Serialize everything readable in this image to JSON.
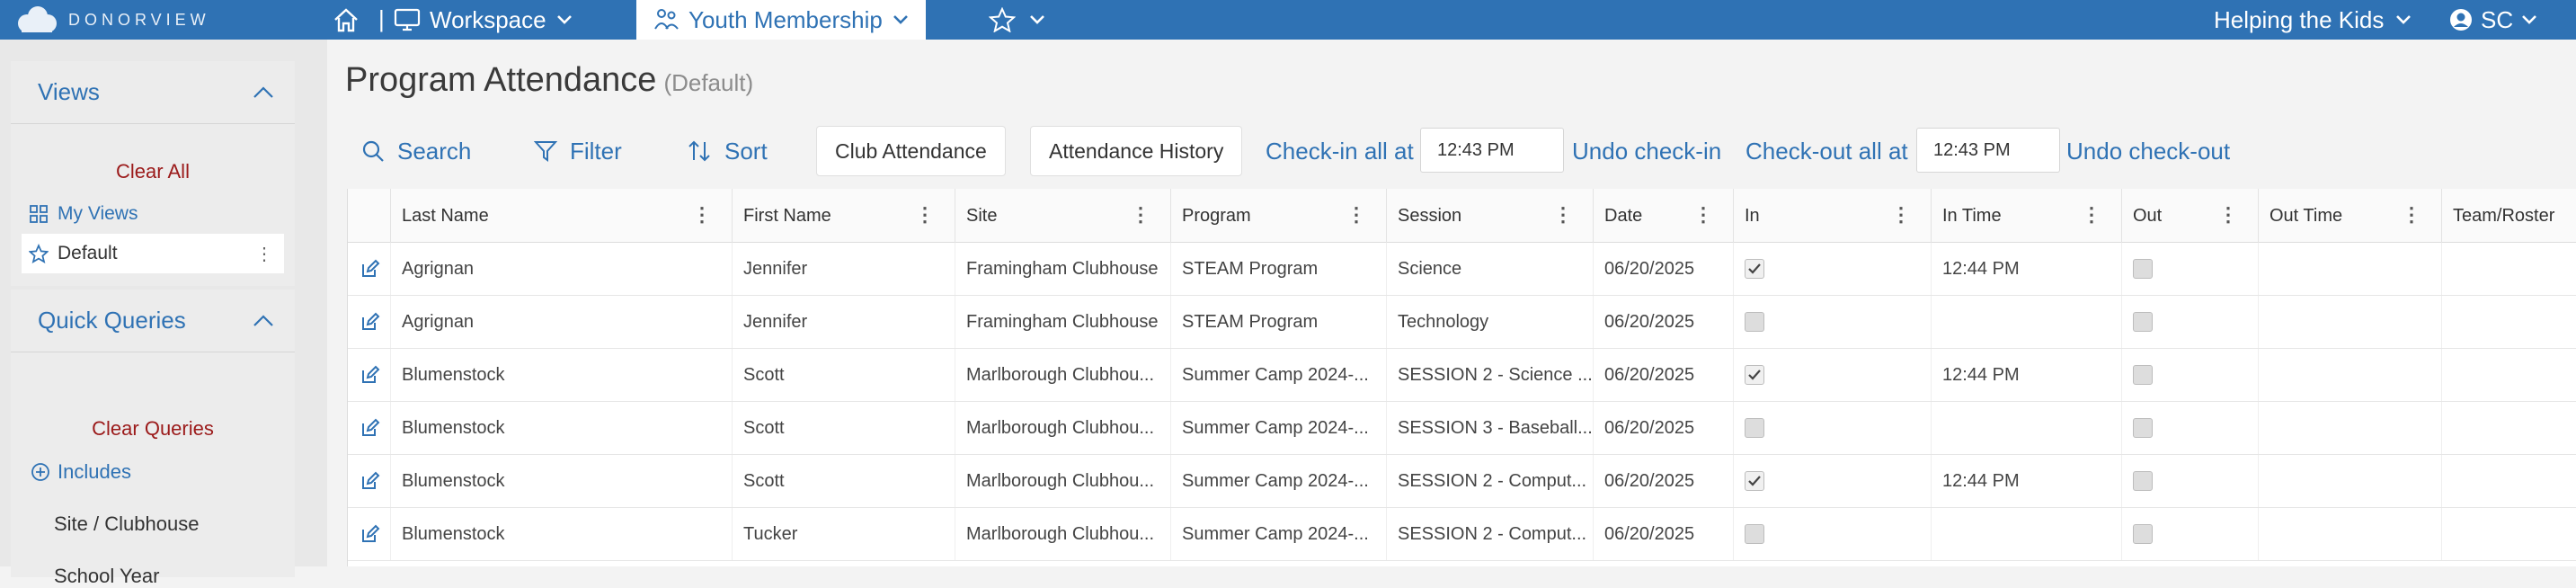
{
  "topbar": {
    "brand": "DONORVIEW",
    "workspace_label": "Workspace",
    "module_label": "Youth Membership",
    "org_label": "Helping the Kids",
    "user_initials": "SC"
  },
  "sidebar": {
    "views": {
      "title": "Views",
      "clear_label": "Clear All",
      "my_views_label": "My Views",
      "default_label": "Default"
    },
    "quick_queries": {
      "title": "Quick Queries",
      "clear_label": "Clear Queries",
      "includes_label": "Includes",
      "items": [
        "Site / Clubhouse",
        "School Year"
      ]
    }
  },
  "page": {
    "title": "Program Attendance",
    "subtitle": "(Default)"
  },
  "toolbar": {
    "search_label": "Search",
    "filter_label": "Filter",
    "sort_label": "Sort",
    "club_attendance_label": "Club Attendance",
    "attendance_history_label": "Attendance History",
    "checkin_all_label": "Check-in all at",
    "checkin_time": "12:43 PM",
    "undo_checkin_label": "Undo check-in",
    "checkout_all_label": "Check-out all at",
    "checkout_time": "12:43 PM",
    "undo_checkout_label": "Undo check-out"
  },
  "grid": {
    "columns": [
      "Last Name",
      "First Name",
      "Site",
      "Program",
      "Session",
      "Date",
      "In",
      "In Time",
      "Out",
      "Out Time",
      "Team/Roster"
    ],
    "rows": [
      {
        "last": "Agrignan",
        "first": "Jennifer",
        "site": "Framingham Clubhouse",
        "program": "STEAM Program",
        "session": "Science",
        "date": "06/20/2025",
        "in": true,
        "in_time": "12:44 PM",
        "out": false,
        "out_time": "",
        "team": ""
      },
      {
        "last": "Agrignan",
        "first": "Jennifer",
        "site": "Framingham Clubhouse",
        "program": "STEAM Program",
        "session": "Technology",
        "date": "06/20/2025",
        "in": false,
        "in_time": "",
        "out": false,
        "out_time": "",
        "team": ""
      },
      {
        "last": "Blumenstock",
        "first": "Scott",
        "site": "Marlborough Clubhou...",
        "program": "Summer Camp 2024-...",
        "session": "SESSION 2 - Science ...",
        "date": "06/20/2025",
        "in": true,
        "in_time": "12:44 PM",
        "out": false,
        "out_time": "",
        "team": ""
      },
      {
        "last": "Blumenstock",
        "first": "Scott",
        "site": "Marlborough Clubhou...",
        "program": "Summer Camp 2024-...",
        "session": "SESSION 3 - Baseball...",
        "date": "06/20/2025",
        "in": false,
        "in_time": "",
        "out": false,
        "out_time": "",
        "team": ""
      },
      {
        "last": "Blumenstock",
        "first": "Scott",
        "site": "Marlborough Clubhou...",
        "program": "Summer Camp 2024-...",
        "session": "SESSION 2 - Comput...",
        "date": "06/20/2025",
        "in": true,
        "in_time": "12:44 PM",
        "out": false,
        "out_time": "",
        "team": ""
      },
      {
        "last": "Blumenstock",
        "first": "Tucker",
        "site": "Marlborough Clubhou...",
        "program": "Summer Camp 2024-...",
        "session": "SESSION 2 - Comput...",
        "date": "06/20/2025",
        "in": false,
        "in_time": "",
        "out": false,
        "out_time": "",
        "team": ""
      }
    ]
  },
  "colors": {
    "brand_blue": "#2f72b4",
    "clear_red": "#9b1a1a"
  },
  "icons": {
    "home": "home-icon",
    "workspace": "monitor-icon",
    "module": "youth-icon",
    "favorites": "star-icon",
    "user": "user-circle-icon",
    "edit": "edit-icon"
  }
}
